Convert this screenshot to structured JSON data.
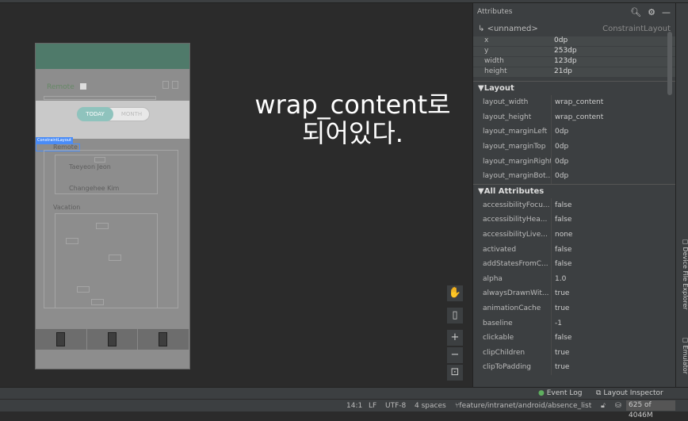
{
  "overlay": {
    "line1": "wrap_content로",
    "line2": "되어있다."
  },
  "device": {
    "title": "Remote",
    "toggle_on": "TODAY",
    "toggle_off": "MONTH",
    "constraint_tag": "ConstraintLayout",
    "items": [
      "Remote",
      "Taeyeon Jeon",
      "Changehee Kim",
      "Vacation"
    ]
  },
  "panel": {
    "title": "Attributes",
    "component_name": "<unnamed>",
    "component_class": "ConstraintLayout",
    "geometry": [
      {
        "k": "x",
        "v": "0dp"
      },
      {
        "k": "y",
        "v": "253dp"
      },
      {
        "k": "width",
        "v": "123dp"
      },
      {
        "k": "height",
        "v": "21dp"
      }
    ],
    "layout_section": "Layout",
    "layout": [
      {
        "k": "layout_width",
        "v": "wrap_content"
      },
      {
        "k": "layout_height",
        "v": "wrap_content"
      },
      {
        "k": "layout_marginLeft",
        "v": "0dp"
      },
      {
        "k": "layout_marginTop",
        "v": "0dp"
      },
      {
        "k": "layout_marginRight",
        "v": "0dp"
      },
      {
        "k": "layout_marginBot...",
        "v": "0dp"
      }
    ],
    "all_section": "All Attributes",
    "all": [
      {
        "k": "accessibilityFocu...",
        "v": "false"
      },
      {
        "k": "accessibilityHea...",
        "v": "false"
      },
      {
        "k": "accessibilityLive...",
        "v": "none"
      },
      {
        "k": "activated",
        "v": "false"
      },
      {
        "k": "addStatesFromC...",
        "v": "false"
      },
      {
        "k": "alpha",
        "v": "1.0"
      },
      {
        "k": "alwaysDrawnWit...",
        "v": "true"
      },
      {
        "k": "animationCache",
        "v": "true"
      },
      {
        "k": "baseline",
        "v": "-1"
      },
      {
        "k": "clickable",
        "v": "false"
      },
      {
        "k": "clipChildren",
        "v": "true"
      },
      {
        "k": "clipToPadding",
        "v": "true"
      }
    ]
  },
  "side_tabs": {
    "device_file_explorer": "Device File Explorer",
    "emulator": "Emulator"
  },
  "bottom": {
    "event_log": "Event Log",
    "layout_inspector": "Layout Inspector"
  },
  "status": {
    "position": "14:1",
    "line_sep": "LF",
    "encoding": "UTF-8",
    "indent": "4 spaces",
    "branch": "feature/intranet/android/absence_list",
    "memory": "625 of 4046M"
  }
}
